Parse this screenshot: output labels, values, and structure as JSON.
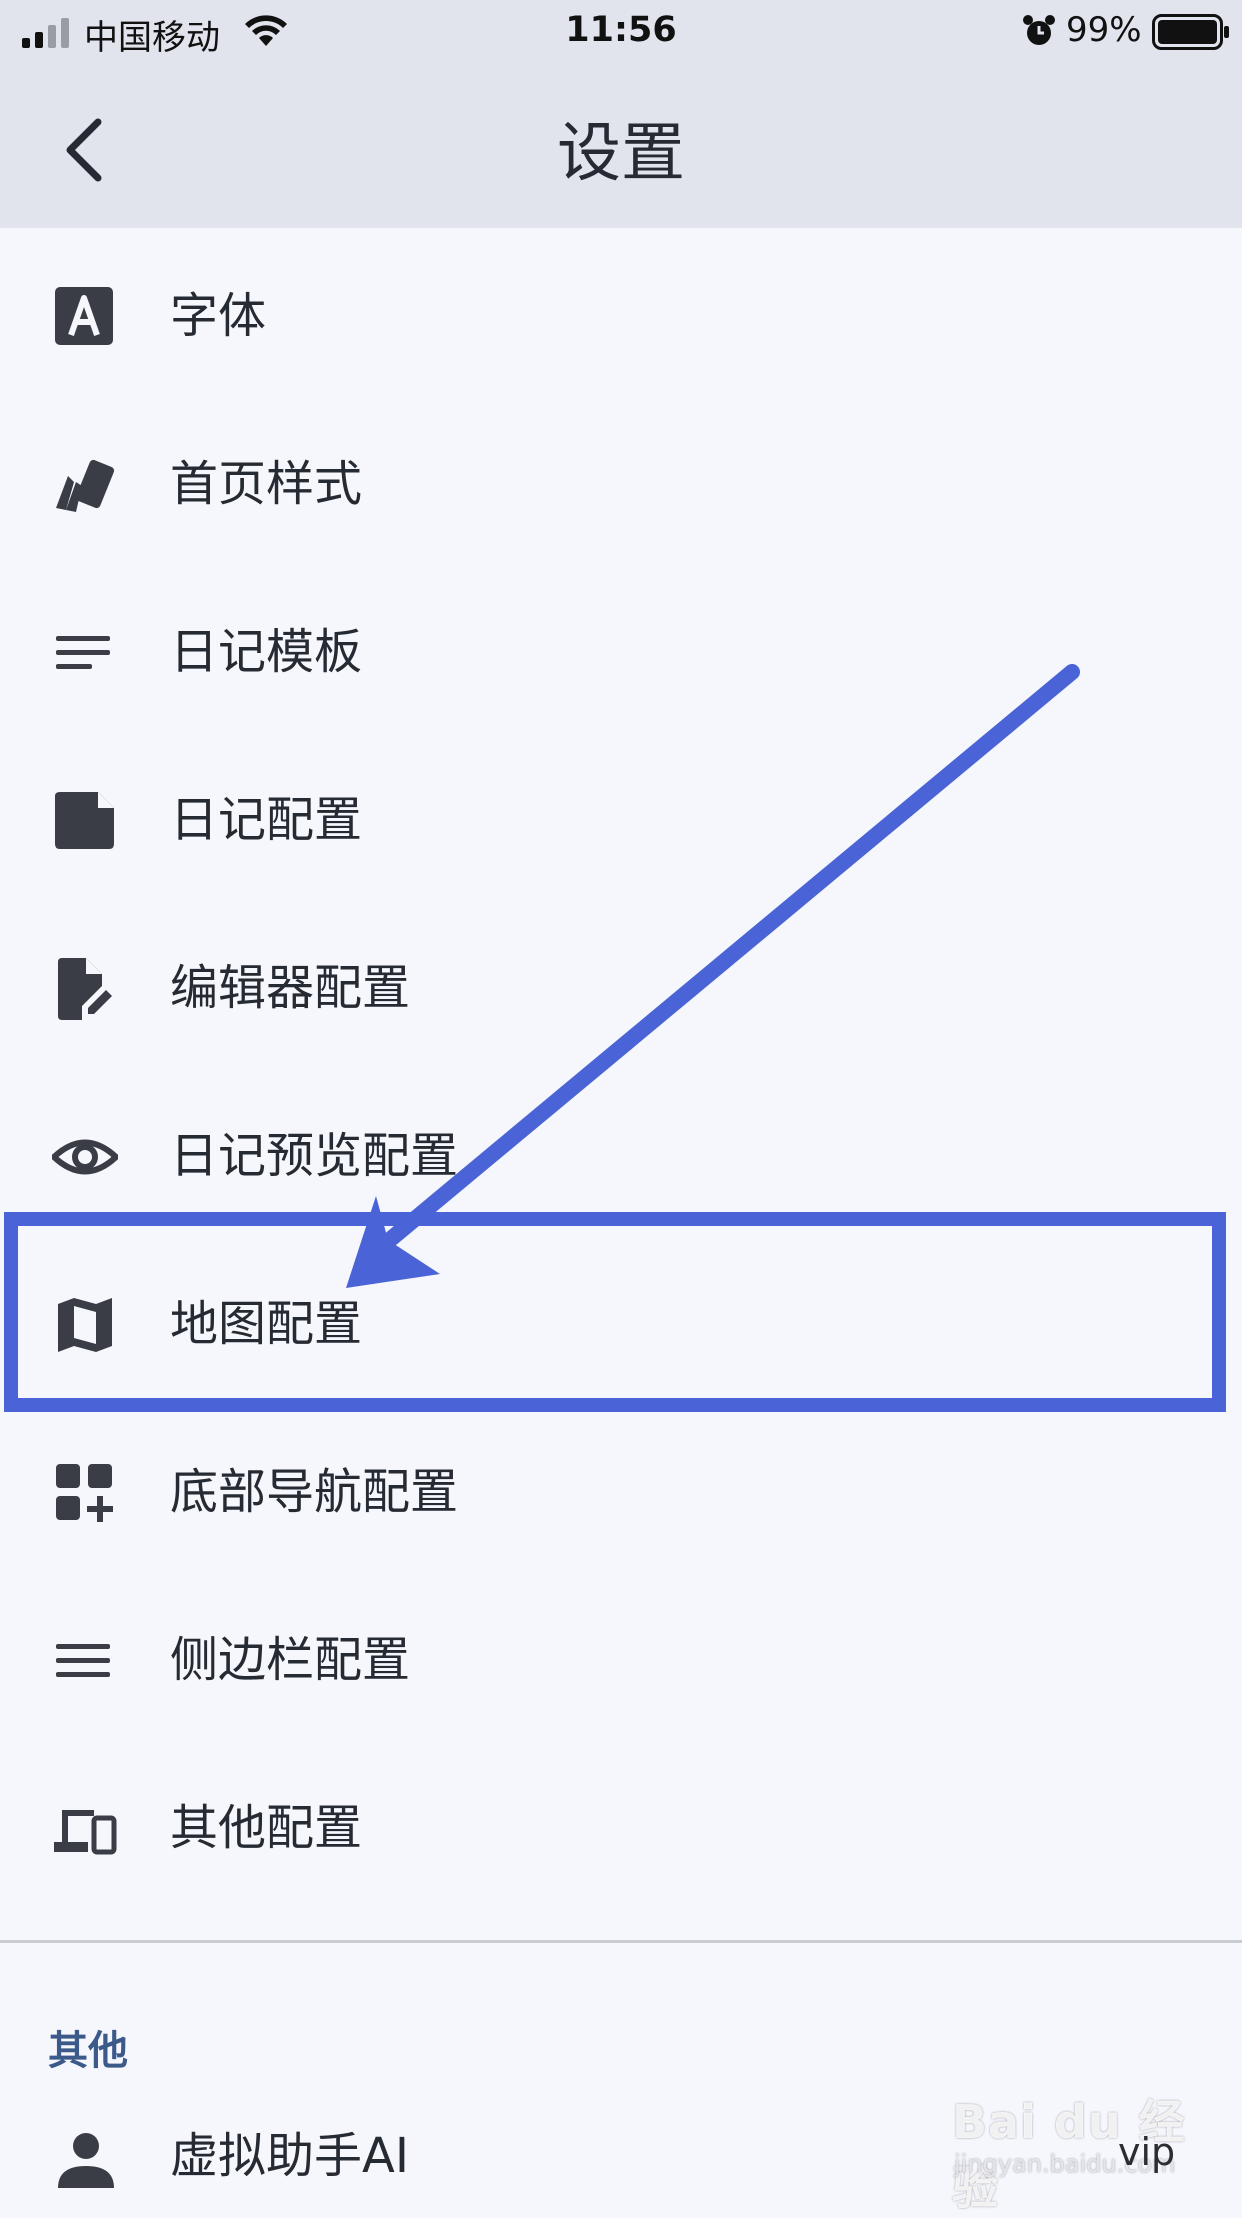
{
  "status_bar": {
    "carrier": "中国移动",
    "time": "11:56",
    "battery_percent": "99%"
  },
  "nav": {
    "title": "设置"
  },
  "settings_items": [
    {
      "label": "字体",
      "icon": "font-a-icon"
    },
    {
      "label": "首页样式",
      "icon": "card-stack-icon"
    },
    {
      "label": "日记模板",
      "icon": "lines-left-icon"
    },
    {
      "label": "日记配置",
      "icon": "note-icon"
    },
    {
      "label": "编辑器配置",
      "icon": "edit-file-icon"
    },
    {
      "label": "日记预览配置",
      "icon": "eye-icon"
    },
    {
      "label": "地图配置",
      "icon": "map-icon"
    },
    {
      "label": "底部导航配置",
      "icon": "grid-plus-icon"
    },
    {
      "label": "侧边栏配置",
      "icon": "menu-lines-icon"
    },
    {
      "label": "其他配置",
      "icon": "devices-icon"
    }
  ],
  "other_section": {
    "title": "其他",
    "items": [
      {
        "label": "虚拟助手AI",
        "icon": "person-icon"
      }
    ]
  },
  "annotation": {
    "highlight_color": "#4a63d6",
    "highlighted_item": "地图配置"
  },
  "watermark": {
    "logo": "Bai du 经验",
    "site": "jingyan.baidu.com",
    "badge": "vip"
  },
  "colors": {
    "bar_bg": "#e1e4ed",
    "page_bg": "#f6f7fd",
    "icon": "#3a3d45",
    "section_title": "#3b5a8a"
  }
}
